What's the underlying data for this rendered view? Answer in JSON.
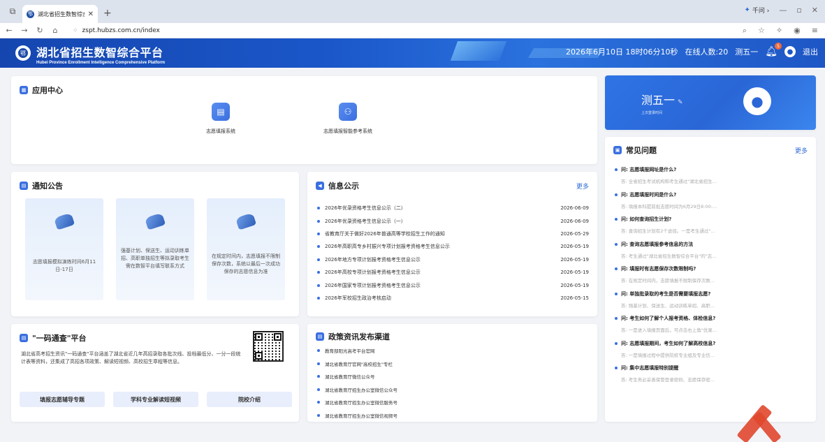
{
  "browser": {
    "tab_title": "湖北省招生数智综合",
    "new_tab_icon": "plus-icon",
    "qianwen_label": "千问 ›",
    "url": "zspt.hubzs.com.cn/index"
  },
  "header": {
    "title_cn": "湖北省招生数智综合平台",
    "title_en": "Hubei Province Enrollment Intelligence Comprehensive Platform",
    "datetime": "2026年6月10日 18时06分10秒",
    "online": "在线人数:20",
    "user": "测五一",
    "badge": "5",
    "logout": "退出"
  },
  "app_center": {
    "title": "应用中心",
    "apps": [
      {
        "label": "志愿填报系统",
        "icon": "form-icon"
      },
      {
        "label": "志愿填报智能参考系统",
        "icon": "ai-people-icon"
      }
    ]
  },
  "profile": {
    "name": "测五一",
    "last_login_label": "上次登录时间"
  },
  "faq": {
    "title": "常见问题",
    "more": "更多",
    "items": [
      {
        "q": "问: 志愿填报网址是什么?",
        "a": "答: 全省招生考试机构和考生通过\"湖北省招生..."
      },
      {
        "q": "问: 志愿填报时间是什么?",
        "a": "答: 填报本科提前批志愿时间为6月29日8:00-..."
      },
      {
        "q": "问: 如何查询招生计划?",
        "a": "答: 查询招生计划有2个途径。一是考生通过\"..."
      },
      {
        "q": "问: 查询志愿填报参考信息的方法",
        "a": "答: 考生通过\"湖北省招生数智综合平台\"的\"志..."
      },
      {
        "q": "问: 填报时有志愿保存次数限制吗?",
        "a": "答: 在规定时间内，志愿填报不限制保存次数..."
      },
      {
        "q": "问: 单独批录取的考生是否需要填报志愿?",
        "a": "答: 强基计划、保送生、运动训练单招、高职..."
      },
      {
        "q": "问: 考生如何了解个人报考资格、体检信息?",
        "a": "答: 一是进入填报页面后，可点击右上角\"优录..."
      },
      {
        "q": "问: 志愿填报期间，考生如何了解高校信息?",
        "a": "答: 一是填报过程中提供院校专业组及专业信..."
      },
      {
        "q": "问: 集中志愿填报特别提醒",
        "a": "答: 考生务必妥善保管登录密码、志愿保存密..."
      }
    ]
  },
  "notices": {
    "title": "通知公告",
    "items": [
      "志愿填报模拟演练时间6月11日-17日",
      "强基计划、保送生、运动训练单招、高职单独招生等拟录取考生需在数智平台填写联系方式",
      "在规定时间内，志愿填报不限制保存次数，系统以最后一次成功保存的志愿信息为准"
    ]
  },
  "info": {
    "title": "信息公示",
    "more": "更多",
    "rows": [
      {
        "t": "2026年优录资格考生信息公示（二）",
        "d": "2026-06-09"
      },
      {
        "t": "2026年优录资格考生信息公示（一）",
        "d": "2026-06-09"
      },
      {
        "t": "省教育厅关于做好2026年普通高等学校招生工作的通知",
        "d": "2026-05-29"
      },
      {
        "t": "2026年高职高专乡村振兴专项计划报考资格考生信息公示",
        "d": "2026-05-19"
      },
      {
        "t": "2026年地方专项计划报考资格考生信息公示",
        "d": "2026-05-19"
      },
      {
        "t": "2026年高校专项计划报考资格考生信息公示",
        "d": "2026-05-19"
      },
      {
        "t": "2026年国家专项计划报考资格考生信息公示",
        "d": "2026-05-19"
      },
      {
        "t": "2026年军校招生政治考核启动",
        "d": "2026-05-15"
      }
    ]
  },
  "onecode": {
    "title": "\"一码通查\"平台",
    "desc": "湖北省高考招生资讯\"一码通查\"平台涵盖了湖北省近几年高招录取各批次线、投档最低分、一分一段统计表等资料，还集成了高招各项政策、解读短视频、高校招生章程等信息。",
    "buttons": [
      "填报志愿辅导专题",
      "学科专业解读短视频",
      "院校介绍"
    ]
  },
  "policy": {
    "title": "政策资讯发布渠道",
    "items": [
      "教育部阳光高考平台官网",
      "湖北省教育厅官网\"高校招生\"专栏",
      "湖北省教育厅微信公众号",
      "湖北省教育厅招生办公室微信公众号",
      "湖北省教育厅招生办公室微信服务号",
      "湖北省教育厅招生办公室微信视频号"
    ]
  }
}
